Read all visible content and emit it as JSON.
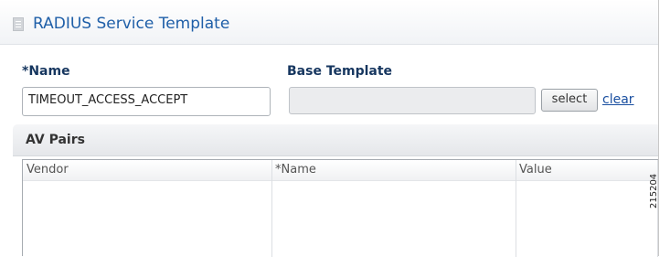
{
  "header": {
    "title": "RADIUS Service Template",
    "icon": "document-icon"
  },
  "form": {
    "name_label": "*Name",
    "name_value": "TIMEOUT_ACCESS_ACCEPT",
    "base_template_label": "Base Template",
    "base_template_value": "",
    "select_button": "select",
    "clear_link": "clear"
  },
  "av_pairs": {
    "title": "AV Pairs",
    "columns": [
      "Vendor",
      "*Name",
      "Value"
    ],
    "rows": []
  },
  "figure_id": "215204",
  "colors": {
    "title": "#1f5fa8",
    "label": "#16365f",
    "link": "#1a4fa0"
  }
}
